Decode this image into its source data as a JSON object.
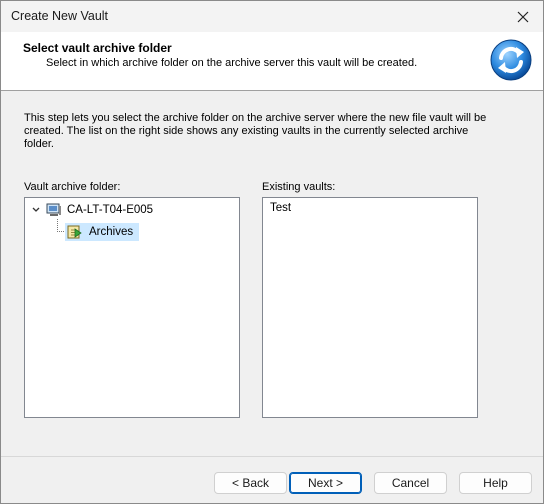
{
  "window": {
    "title": "Create New Vault"
  },
  "header": {
    "title": "Select vault archive folder",
    "subtitle": "Select in which archive folder on the archive server this vault will be created."
  },
  "description": "This step lets you select the archive folder on the archive server where the new file vault will be created. The list on the right side shows any existing vaults in the currently selected archive folder.",
  "folder_panel": {
    "label": "Vault archive folder:",
    "tree": {
      "server": "CA-LT-T04-E005",
      "selected_child": "Archives"
    }
  },
  "vaults_panel": {
    "label": "Existing vaults:",
    "items": [
      "Test"
    ]
  },
  "buttons": {
    "back": "< Back",
    "next": "Next >",
    "cancel": "Cancel",
    "help": "Help"
  }
}
